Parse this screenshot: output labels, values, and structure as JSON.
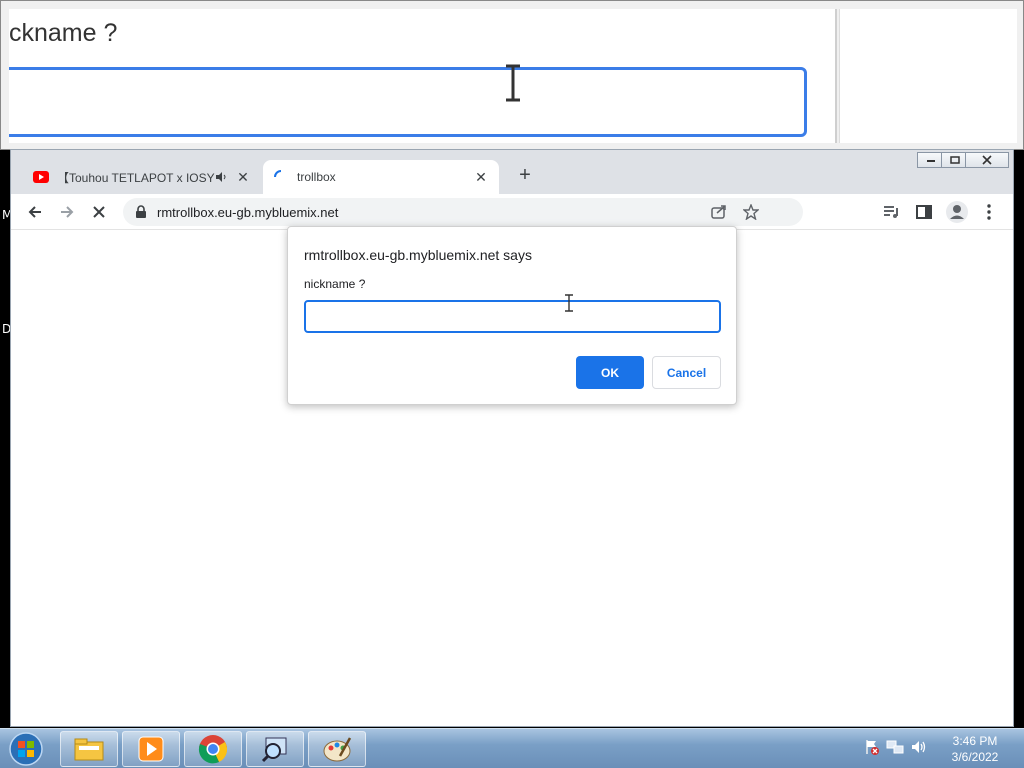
{
  "magnifier": {
    "label_fragment": "ckname ?"
  },
  "desktop": {
    "letters": [
      "M",
      "D"
    ]
  },
  "browser": {
    "tabs": [
      {
        "title": "【Touhou TETLAPOT x IOSYS】",
        "favicon": "youtube-icon",
        "audio": "speaker-icon"
      },
      {
        "title": "trollbox",
        "favicon": "loading-spinner-icon"
      }
    ],
    "url": "rmtrollbox.eu-gb.mybluemix.net"
  },
  "dialog": {
    "title": "rmtrollbox.eu-gb.mybluemix.net says",
    "message": "nickname ?",
    "input_value": "",
    "ok_label": "OK",
    "cancel_label": "Cancel"
  },
  "taskbar": {
    "apps": [
      "file-explorer-icon",
      "media-player-icon",
      "chrome-icon",
      "magnifier-icon",
      "paint-icon"
    ],
    "time": "3:46 PM",
    "date": "3/6/2022"
  },
  "colors": {
    "accent": "#1a73e8",
    "taskbar": "#7a9fc6"
  }
}
